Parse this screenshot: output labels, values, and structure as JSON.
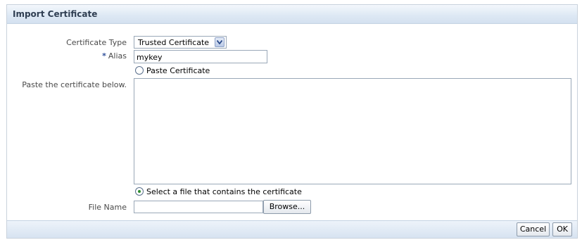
{
  "dialog": {
    "title": "Import Certificate"
  },
  "form": {
    "certificate_type": {
      "label": "Certificate Type",
      "selected": "Trusted Certificate"
    },
    "alias": {
      "required_marker": "*",
      "label": "Alias",
      "value": "mykey"
    },
    "paste_option": {
      "label": "Paste Certificate",
      "checked": false
    },
    "paste_area": {
      "label": "Paste the certificate below.",
      "value": ""
    },
    "file_option": {
      "label": "Select a file that contains the certificate",
      "checked": true
    },
    "file_name": {
      "label": "File Name",
      "value": "",
      "browse_label": "Browse..."
    }
  },
  "footer": {
    "cancel_label": "Cancel",
    "ok_label": "OK"
  },
  "colors": {
    "title_text": "#2f3e52",
    "selected_radio": "#2e8b2e",
    "required_marker": "#2f4f9a"
  }
}
